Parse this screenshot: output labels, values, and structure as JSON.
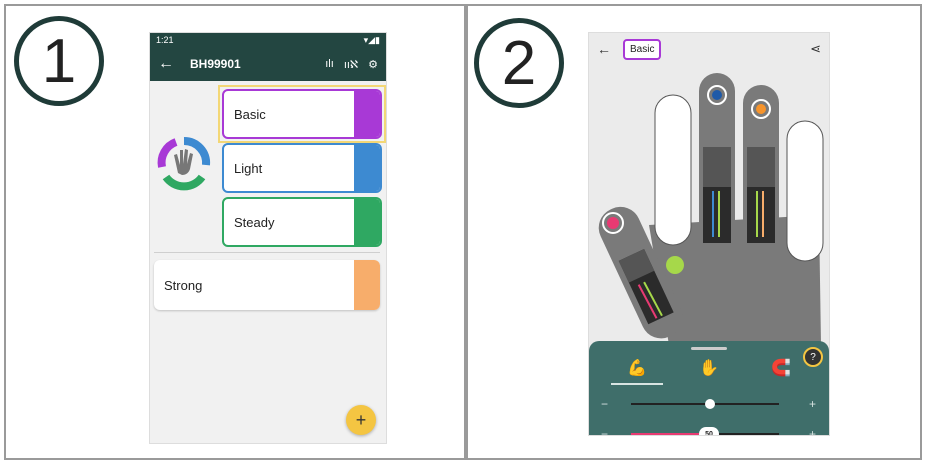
{
  "steps": {
    "one": "1",
    "two": "2"
  },
  "screen1": {
    "status_time": "1:21",
    "status_icons": "▾◢▮",
    "title": "BH99901",
    "back_icon": "←",
    "actions": [
      "ılı",
      "ııℵ",
      "⚙"
    ],
    "cards": [
      {
        "label": "Basic",
        "color": "#a839d6"
      },
      {
        "label": "Light",
        "color": "#3d8ad1"
      },
      {
        "label": "Steady",
        "color": "#2fa862"
      },
      {
        "label": "Strong",
        "color": "#f7ad6b"
      }
    ],
    "fab": "+"
  },
  "screen2": {
    "back_icon": "←",
    "profile_label": "Basic",
    "share_icon": "⋖",
    "help": "?",
    "tabs": [
      "arm-icon",
      "hand-pad-icon",
      "magnet-icon"
    ],
    "slider_value": "50",
    "minus": "−",
    "plus": "+"
  }
}
